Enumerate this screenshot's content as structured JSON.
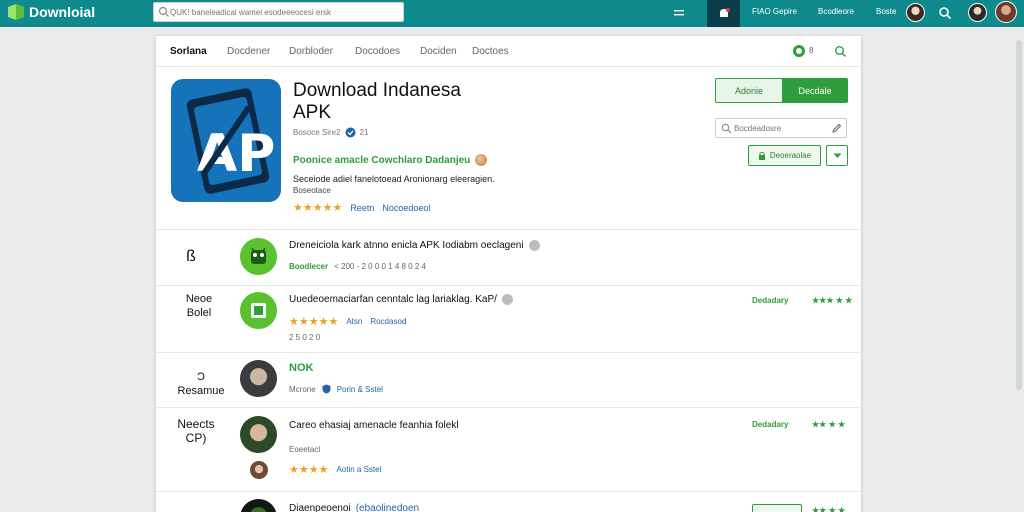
{
  "topbar": {
    "logo": "Downloial",
    "search_placeholder": "QUK! baneleadical wamel esodeeeocesi ersk",
    "link_1": "FIAO Gepire",
    "link_2": "Bcodleore",
    "link_3": "Boste"
  },
  "tabs": {
    "items": [
      "Sorlana",
      "Docdener",
      "Dorbloder",
      "Docodoes",
      "Dociden",
      "Doctoes"
    ],
    "status_count": "8"
  },
  "app": {
    "title": "Download Indanesa",
    "subtitle": "APK",
    "meta": "Bosoce Sire2",
    "meta_count": "21",
    "green_line": "Poonice amacle Cowchlaro Dadanjeu",
    "description": "Seceiode adiel fanelotoead Aronionarg eleeragien.",
    "description_2": "Boseotace",
    "rating_label": "Reetn",
    "rating_link": "Nocoedoeol"
  },
  "actions": {
    "outline_btn": "Adonie",
    "solid_btn": "Decdale",
    "search_placeholder": "Bocdeadosre",
    "green_btn": "Deoeraolae"
  },
  "rows": [
    {
      "side": "ß",
      "title": "Dreneiciola kark atnno enicla APK Iodiabm oeclageni",
      "meta": "Boodlecer",
      "meta_2": "< 200 - 2 0 0 0 1 4 8 0 2 4"
    },
    {
      "side": "Neoe\nBolel",
      "title": "Uuedeoemaciarfan cenntalc lag lariaklag. KaP/",
      "rating_label": "Atsn",
      "rating_link": "Rocdasod",
      "meta": "2 5 0 2 0",
      "right_label": "Dedadary",
      "right_stars": "★★★ ★ ★"
    },
    {
      "side": "Ɔ\nResamue",
      "title": "NOK",
      "meta": "Mcrone",
      "meta_link": "Porin & Sstel"
    },
    {
      "side": "Neects\nCP)",
      "title": "Careo ehasiaj amenacle feanhia folekl",
      "meta": "Eoeetacl",
      "rating_link": "Aotin a Sstel",
      "right_label": "Dedadary",
      "right_stars": "★★ ★ ★"
    },
    {
      "title": "Diaenpeoenoi",
      "title_link": "(ebaolinedoen",
      "right_stars": "★★ ★ ★"
    }
  ],
  "colors": {
    "topbar": "#0f8a8c",
    "accent_green": "#2d9e3b",
    "link_blue": "#2463a7",
    "star": "#e9a324"
  }
}
